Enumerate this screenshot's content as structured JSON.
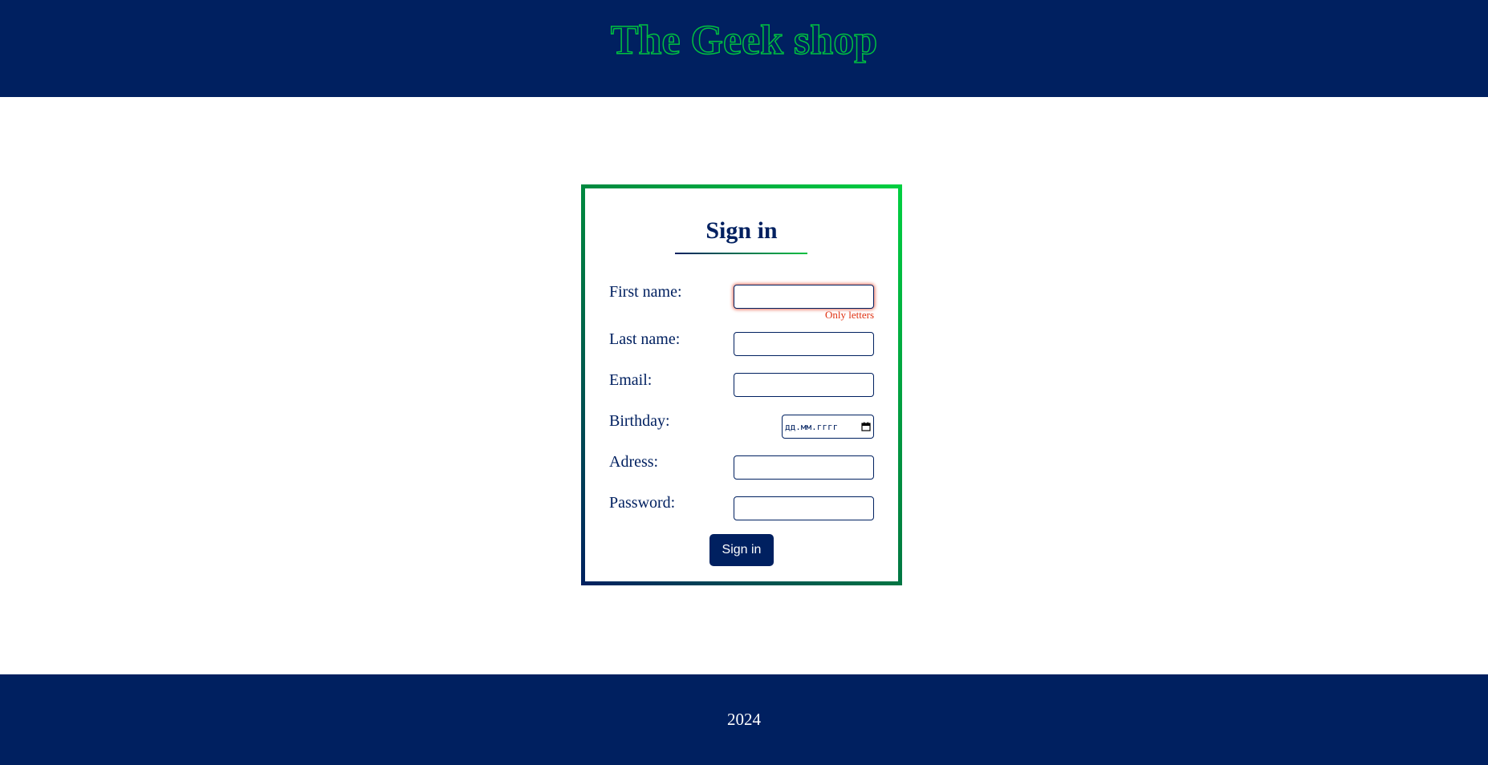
{
  "header": {
    "site_title": "The Geek shop"
  },
  "form": {
    "title": "Sign in",
    "fields": {
      "first_name": {
        "label": "First name:",
        "value": "",
        "error": "Only letters"
      },
      "last_name": {
        "label": "Last name:",
        "value": ""
      },
      "email": {
        "label": "Email:",
        "value": ""
      },
      "birthday": {
        "label": "Birthday:",
        "placeholder": "дд.мм.гггг"
      },
      "address": {
        "label": "Adress:",
        "value": ""
      },
      "password": {
        "label": "Password:",
        "value": ""
      }
    },
    "submit_label": "Sign in"
  },
  "footer": {
    "text": "2024"
  },
  "colors": {
    "primary": "#002060",
    "accent": "#00c040",
    "error": "#e03010"
  },
  "icons": {
    "birthday_picker": "calendar-icon"
  }
}
